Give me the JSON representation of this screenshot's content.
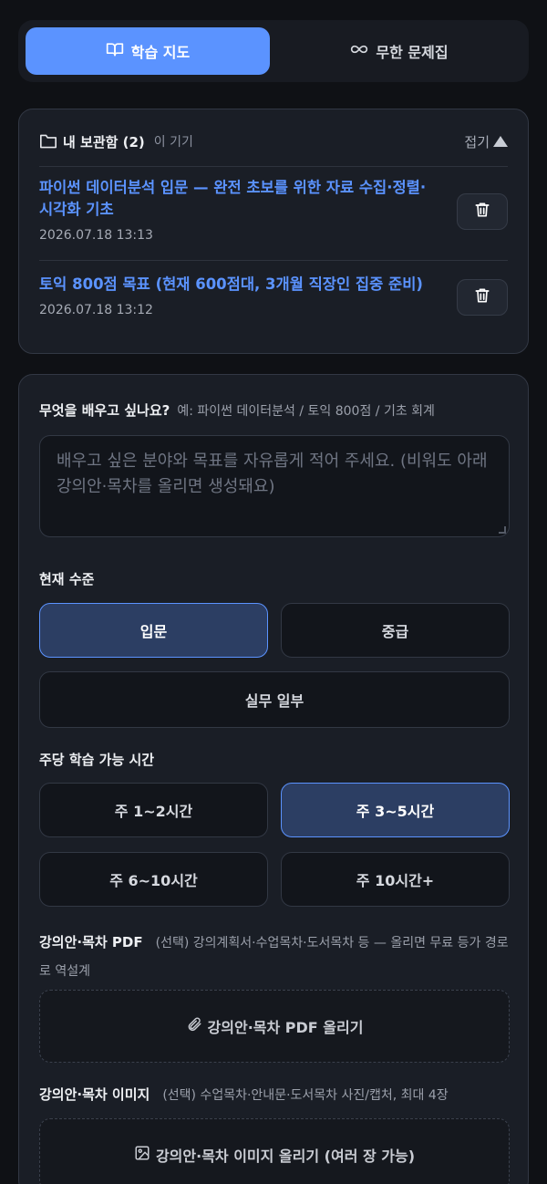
{
  "tabs": [
    {
      "label": "학습 지도",
      "icon": "book-icon",
      "active": true
    },
    {
      "label": "무한 문제집",
      "icon": "infinity-icon",
      "active": false
    }
  ],
  "saved": {
    "title": "내 보관함 (2)",
    "subtitle": "이 기기",
    "collapse_label": "접기",
    "items": [
      {
        "title": "파이썬 데이터분석 입문 — 완전 초보를 위한 자료 수집·정렬·시각화 기초",
        "date": "2026.07.18 13:13"
      },
      {
        "title": "토익 800점 목표 (현재 600점대, 3개월 직장인 집중 준비)",
        "date": "2026.07.18 13:12"
      }
    ]
  },
  "form": {
    "goal": {
      "label": "무엇을 배우고 싶나요?",
      "hint": "예: 파이썬 데이터분석 / 토익 800점 / 기초 회계",
      "placeholder": "배우고 싶은 분야와 목표를 자유롭게 적어 주세요. (비워도 아래 강의안·목차를 올리면 생성돼요)"
    },
    "level": {
      "label": "현재 수준",
      "options": [
        "입문",
        "중급",
        "실무 일부"
      ],
      "selected": "입문"
    },
    "hours": {
      "label": "주당 학습 가능 시간",
      "options": [
        "주 1~2시간",
        "주 3~5시간",
        "주 6~10시간",
        "주 10시간+"
      ],
      "selected": "주 3~5시간"
    },
    "pdf": {
      "label": "강의안·목차 PDF",
      "hint": "(선택) 강의계획서·수업목차·도서목차 등 — 올리면 무료 등가 경로로 역설계",
      "button": "강의안·목차 PDF 올리기"
    },
    "image": {
      "label": "강의안·목차 이미지",
      "hint": "(선택) 수업목차·안내문·도서목차 사진/캡처, 최대 4장",
      "button": "강의안·목차 이미지 올리기 (여러 장 가능)"
    }
  },
  "colors": {
    "accent": "#5b93ff",
    "background": "#0f1115",
    "card": "#1a1e26"
  }
}
